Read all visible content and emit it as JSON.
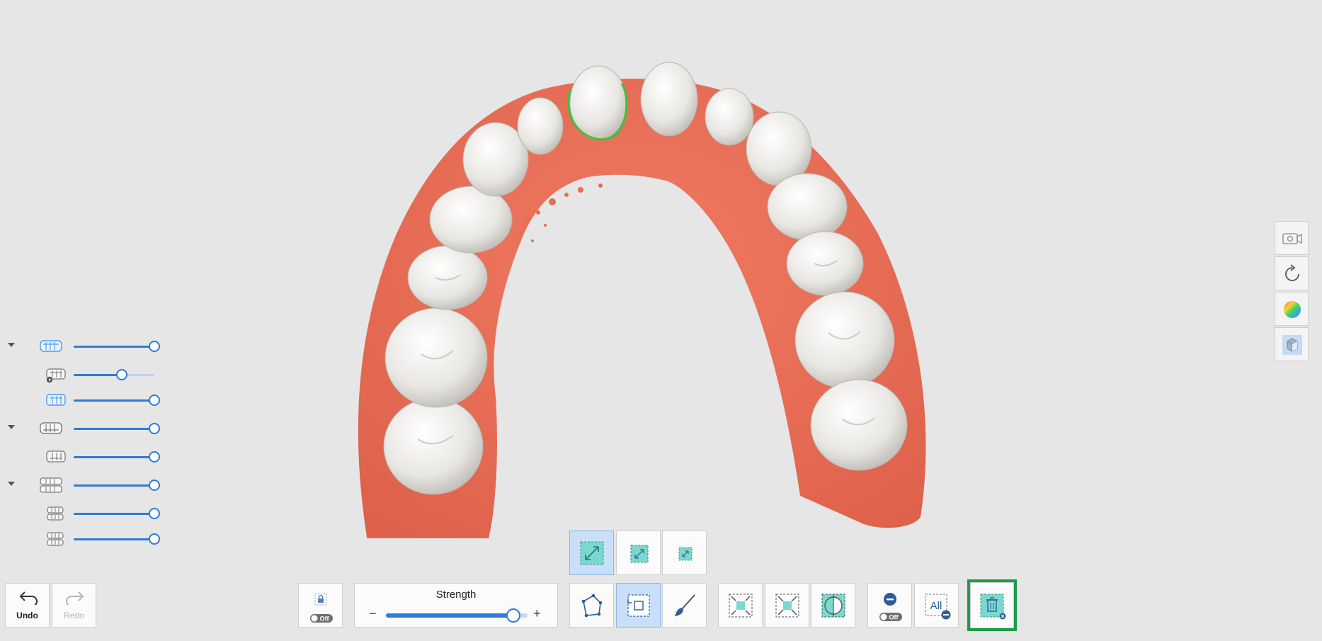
{
  "colors": {
    "accent": "#2e7bd6",
    "gum": "#e56c55",
    "tooth": "#eceae6",
    "margin_line": "#3cc23c",
    "highlight": "#1e9b48",
    "tool_teal": "#7ad9cf"
  },
  "layers": [
    {
      "icon": "upper-jaw-icon",
      "expandable": true,
      "level": 1.0
    },
    {
      "icon": "upper-jaw-prep-icon",
      "expandable": false,
      "level": 0.6
    },
    {
      "icon": "upper-jaw-scan-icon",
      "expandable": false,
      "level": 1.0
    },
    {
      "icon": "lower-jaw-icon",
      "expandable": true,
      "level": 1.0
    },
    {
      "icon": "lower-jaw-scan-icon",
      "expandable": false,
      "level": 1.0
    },
    {
      "icon": "occlusion-icon",
      "expandable": true,
      "level": 1.0
    },
    {
      "icon": "occlusion-scan-1-icon",
      "expandable": false,
      "level": 1.0
    },
    {
      "icon": "occlusion-scan-2-icon",
      "expandable": false,
      "level": 1.0
    }
  ],
  "right_tools": [
    {
      "icon": "camera-icon"
    },
    {
      "icon": "reset-view-icon"
    },
    {
      "icon": "color-map-icon"
    },
    {
      "icon": "view-cube-icon"
    }
  ],
  "toolbar": {
    "undo_label": "Undo",
    "redo_label": "Redo",
    "lock_state": "Off",
    "strength_label": "Strength",
    "strength_minus": "−",
    "strength_plus": "+",
    "strength_level": 0.9,
    "hide_toggle_state": "Off",
    "all_label": "All"
  },
  "selection_sizes": [
    "large",
    "medium",
    "small"
  ]
}
